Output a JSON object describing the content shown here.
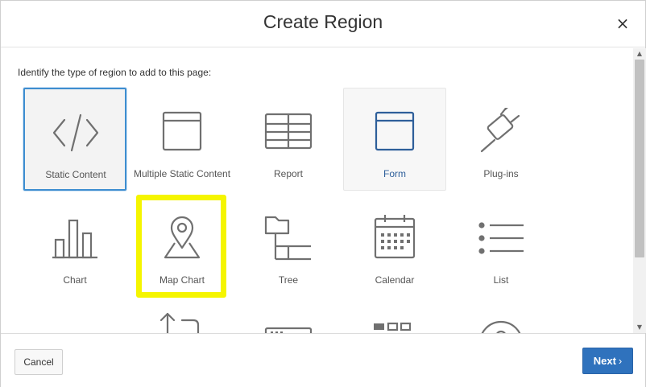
{
  "dialog": {
    "title": "Create Region",
    "close_glyph": "×"
  },
  "body": {
    "prompt": "Identify the type of region to add to this page:"
  },
  "tiles": [
    {
      "label": "Static Content",
      "icon": "code-icon",
      "state": "selected"
    },
    {
      "label": "Multiple Static Content",
      "icon": "window-icon",
      "state": "normal"
    },
    {
      "label": "Report",
      "icon": "table-icon",
      "state": "normal"
    },
    {
      "label": "Form",
      "icon": "form-icon",
      "state": "hover"
    },
    {
      "label": "Plug-ins",
      "icon": "plug-icon",
      "state": "normal"
    },
    {
      "label": "Chart",
      "icon": "bar-chart-icon",
      "state": "normal"
    },
    {
      "label": "Map Chart",
      "icon": "map-pin-icon",
      "state": "normal"
    },
    {
      "label": "Tree",
      "icon": "tree-icon",
      "state": "normal"
    },
    {
      "label": "Calendar",
      "icon": "calendar-icon",
      "state": "normal"
    },
    {
      "label": "List",
      "icon": "list-icon",
      "state": "normal"
    }
  ],
  "footer": {
    "cancel_label": "Cancel",
    "next_label": "Next",
    "next_chevron": "›"
  },
  "colors": {
    "accent": "#2f72bd",
    "selected_border": "#3e8ed0",
    "highlight": "#f5f500",
    "icon_stroke": "#6f6f6f",
    "hover_label": "#2e5f9a"
  }
}
